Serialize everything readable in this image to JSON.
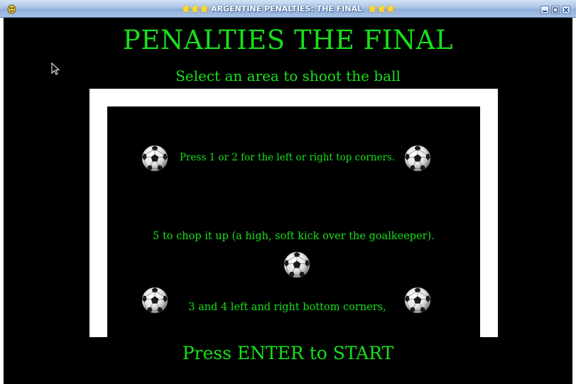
{
  "window": {
    "title": "ARGENTINE PENALTIES: THE FINAL",
    "title_stars_left": "⭐⭐⭐",
    "title_stars_right": "⭐⭐⭐",
    "buttons": [
      "minimize-icon",
      "maximize-icon",
      "close-icon"
    ]
  },
  "game": {
    "title": "PENALTIES THE FINAL",
    "subtitle": "Select an area to shoot the ball",
    "instructions": {
      "top": "Press 1 or 2 for the left or right top corners.",
      "middle": "5 to chop it up (a high, soft kick over the goalkeeper).",
      "bottom": "3 and 4 left and right bottom corners,"
    },
    "start_prompt": "Press ENTER to START",
    "balls": [
      "top-left",
      "top-right",
      "center",
      "bottom-left",
      "bottom-right"
    ]
  },
  "colors": {
    "text_green": "#18e01a",
    "background": "#000000",
    "goal_posts": "#ffffff"
  }
}
